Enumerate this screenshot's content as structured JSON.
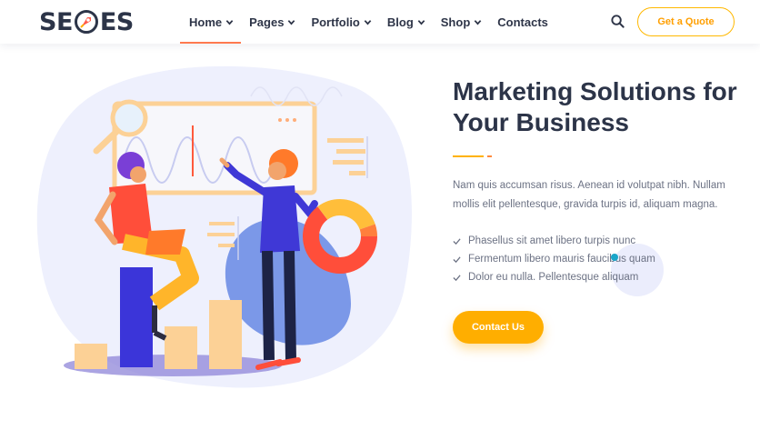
{
  "brand": {
    "logo_left": "SE",
    "logo_right": "ES"
  },
  "nav": {
    "items": [
      {
        "label": "Home",
        "active": true
      },
      {
        "label": "Pages"
      },
      {
        "label": "Portfolio"
      },
      {
        "label": "Blog"
      },
      {
        "label": "Shop"
      },
      {
        "label": "Contacts"
      }
    ],
    "search_icon": "search-icon",
    "quote_button": "Get a Quote"
  },
  "hero": {
    "title_bold": "Marketing Solutions",
    "title_rest_1": " for",
    "title_rest_2": "Your Business",
    "description": "Nam quis accumsan risus. Aenean id volutpat nibh. Nullam mollis elit pellentesque, gravida turpis id, aliquam magna.",
    "features": [
      "Phasellus sit amet libero turpis nunc",
      "Fermentum libero mauris faucibus quam",
      "Dolor eu nulla. Pellentesque aliquam"
    ],
    "cta": "Contact Us"
  },
  "colors": {
    "accent_orange": "#ff7a4f",
    "accent_yellow": "#ffae00",
    "text_dark": "#2c3448",
    "text_muted": "#6c7284"
  }
}
